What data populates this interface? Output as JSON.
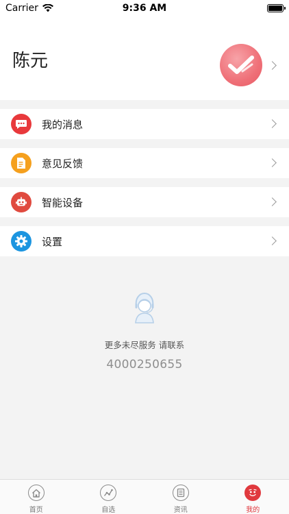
{
  "status_bar": {
    "carrier": "Carrier",
    "time": "9:36 AM"
  },
  "profile": {
    "name": "陈元"
  },
  "menu": [
    {
      "label": "我的消息",
      "icon": "chat-icon",
      "color": "#e8393c"
    },
    {
      "label": "意见反馈",
      "icon": "feedback-icon",
      "color": "#f5a01e"
    },
    {
      "label": "智能设备",
      "icon": "robot-icon",
      "color": "#e04a3f"
    },
    {
      "label": "设置",
      "icon": "gear-icon",
      "color": "#1c95e0"
    }
  ],
  "contact": {
    "text": "更多未尽服务 请联系",
    "phone": "4000250655"
  },
  "tabs": [
    {
      "label": "首页",
      "icon": "home-icon",
      "active": false
    },
    {
      "label": "自选",
      "icon": "chart-icon",
      "active": false
    },
    {
      "label": "资讯",
      "icon": "news-icon",
      "active": false
    },
    {
      "label": "我的",
      "icon": "profile-icon",
      "active": true
    }
  ],
  "colors": {
    "accent": "#e0393e",
    "background": "#f3f3f3"
  }
}
